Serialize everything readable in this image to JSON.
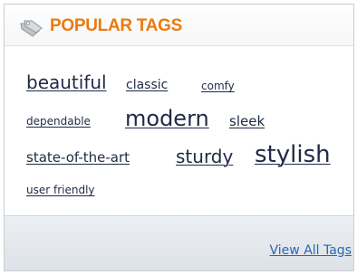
{
  "widget": {
    "title": "POPULAR TAGS",
    "icon": "tag-icon",
    "accent_color": "#ec7a0e",
    "link_color": "#2a66b8"
  },
  "tags": [
    {
      "label": "beautiful"
    },
    {
      "label": "classic"
    },
    {
      "label": "comfy"
    },
    {
      "label": "dependable"
    },
    {
      "label": "modern"
    },
    {
      "label": "sleek"
    },
    {
      "label": "state-of-the-art"
    },
    {
      "label": "sturdy"
    },
    {
      "label": "stylish"
    },
    {
      "label": "user friendly"
    }
  ],
  "footer": {
    "view_all_label": "View All Tags"
  }
}
